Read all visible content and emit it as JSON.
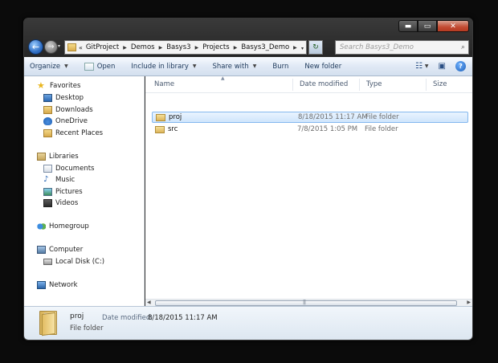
{
  "window": {
    "caption": {
      "minimize": "▬",
      "maximize": "▭",
      "close": "✕"
    }
  },
  "nav": {
    "back_glyph": "←",
    "forward_glyph": "→",
    "recent_glyph": "▾",
    "address_overflow": "«",
    "breadcrumb": [
      "GitProject",
      "Demos",
      "Basys3",
      "Projects",
      "Basys3_Demo"
    ],
    "crumb_sep": "▶",
    "address_dropdown": "▾",
    "refresh_glyph": "↻",
    "search_placeholder": "Search Basys3_Demo",
    "search_glyph": "⌕"
  },
  "toolbar": {
    "organize": "Organize",
    "open": "Open",
    "include_in_library": "Include in library",
    "share_with": "Share with",
    "burn": "Burn",
    "new_folder": "New folder",
    "dd": "▼",
    "views_glyph": "☷",
    "preview_glyph": "▣",
    "help_glyph": "?"
  },
  "sidebar": {
    "favorites": {
      "label": "Favorites",
      "items": [
        "Desktop",
        "Downloads",
        "OneDrive",
        "Recent Places"
      ]
    },
    "libraries": {
      "label": "Libraries",
      "items": [
        "Documents",
        "Music",
        "Pictures",
        "Videos"
      ]
    },
    "homegroup": {
      "label": "Homegroup"
    },
    "computer": {
      "label": "Computer",
      "items": [
        "Local Disk (C:)"
      ]
    },
    "network": {
      "label": "Network"
    },
    "star_glyph": "★",
    "note_glyph": "♪"
  },
  "columns": {
    "name": "Name",
    "date": "Date modified",
    "type": "Type",
    "size": "Size",
    "sort_glyph": "▲"
  },
  "files": [
    {
      "name": "proj",
      "date": "8/18/2015 11:17 AM",
      "type": "File folder",
      "selected": true
    },
    {
      "name": "src",
      "date": "7/8/2015 1:05 PM",
      "type": "File folder",
      "selected": false
    }
  ],
  "scrollbar": {
    "left": "◀",
    "right": "▶",
    "grip": "|||"
  },
  "details": {
    "name": "proj",
    "type": "File folder",
    "date_label": "Date modified:",
    "date_value": "8/18/2015 11:17 AM"
  }
}
